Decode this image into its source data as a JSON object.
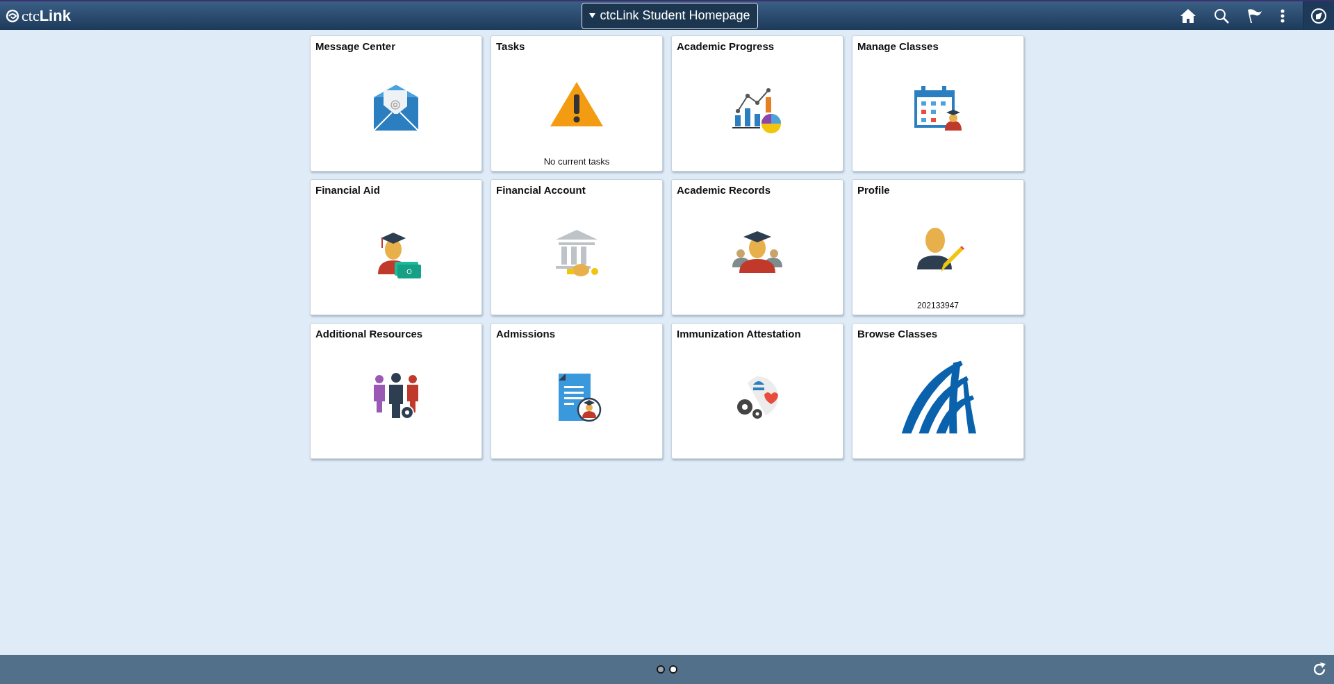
{
  "header": {
    "logo": "ctc**Link**",
    "title": "ctcLink Student Homepage"
  },
  "tiles": [
    {
      "title": "Message Center",
      "kind": "envelope"
    },
    {
      "title": "Tasks",
      "kind": "warning",
      "note": "No current tasks"
    },
    {
      "title": "Academic Progress",
      "kind": "chart"
    },
    {
      "title": "Manage Classes",
      "kind": "calendar"
    },
    {
      "title": "Financial Aid",
      "kind": "graduate-money"
    },
    {
      "title": "Financial Account",
      "kind": "bank"
    },
    {
      "title": "Academic Records",
      "kind": "graduates"
    },
    {
      "title": "Profile",
      "kind": "profile",
      "note": "202133947"
    },
    {
      "title": "Additional Resources",
      "kind": "people"
    },
    {
      "title": "Admissions",
      "kind": "document"
    },
    {
      "title": "Immunization Attestation",
      "kind": "health"
    },
    {
      "title": "Browse Classes",
      "kind": "arches"
    }
  ],
  "pages": [
    {
      "selected": true
    },
    {
      "selected": false
    }
  ]
}
